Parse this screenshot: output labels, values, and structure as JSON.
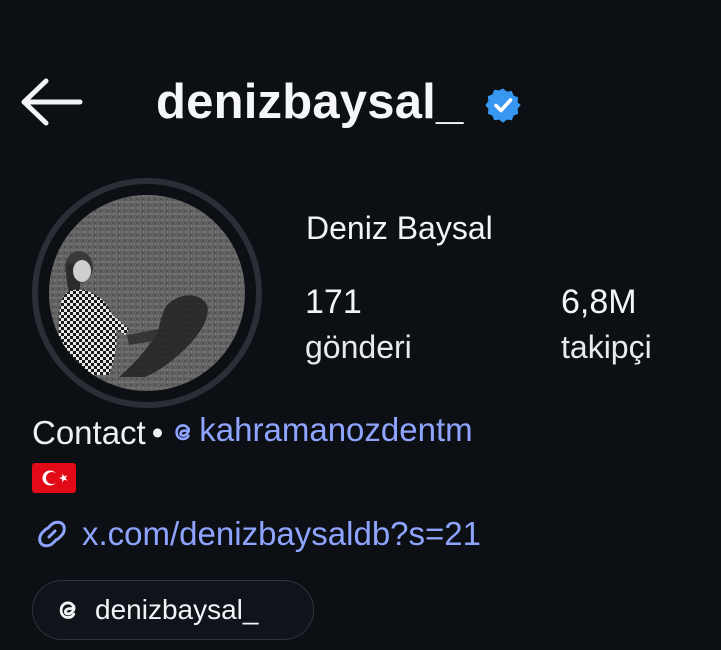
{
  "header": {
    "username": "denizbaysal_",
    "verified_icon": "verified-badge-icon",
    "back_icon": "arrow-left-icon"
  },
  "profile": {
    "display_name": "Deniz Baysal",
    "stats": {
      "posts_value": "171",
      "posts_label": "gönderi",
      "followers_value": "6,8M",
      "followers_label": "takipçi"
    }
  },
  "bio": {
    "contact_label": "Contact",
    "separator": "•",
    "mention_handle": "kahramanozdentm",
    "flag_emoji": "🇹🇷",
    "link_text": "x.com/denizbaysaldb?s=21"
  },
  "threads_chip": {
    "label": "denizbaysal_"
  },
  "colors": {
    "background": "#0c0f14",
    "text": "#f2f4f7",
    "link": "#8ea4ff",
    "verified": "#3897f0",
    "avatar_ring": "#2a2f36"
  }
}
